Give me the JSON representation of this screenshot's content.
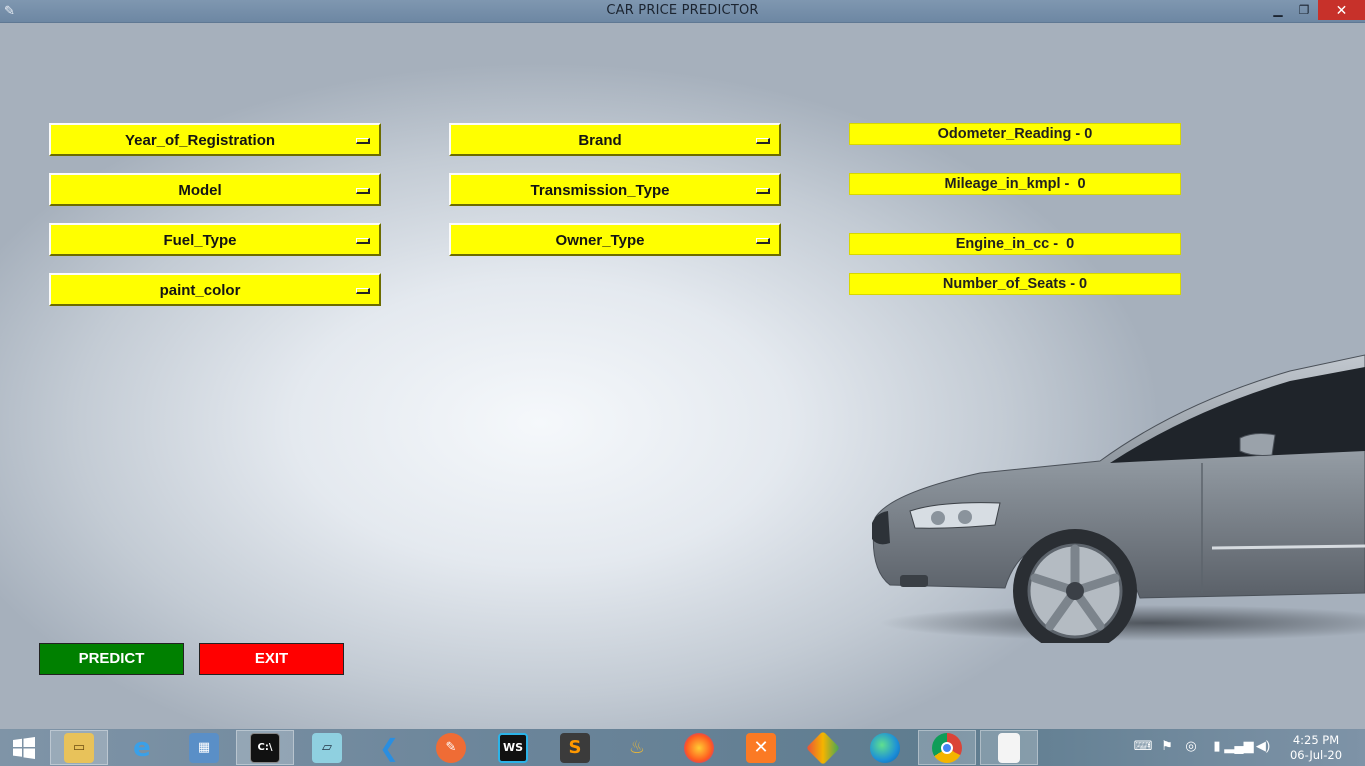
{
  "window": {
    "title": "CAR PRICE PREDICTOR",
    "minimize": "▁",
    "maximize": "❐",
    "close": "✕"
  },
  "dropdowns": {
    "year": "Year_of_Registration",
    "brand": "Brand",
    "model": "Model",
    "transmission": "Transmission_Type",
    "fuel": "Fuel_Type",
    "owner": "Owner_Type",
    "paint": "paint_color"
  },
  "info": {
    "odometer": "Odometer_Reading - 0",
    "mileage": "Mileage_in_kmpl -  0",
    "engine": "Engine_in_cc -  0",
    "seats": "Number_of_Seats - 0"
  },
  "buttons": {
    "predict": "PREDICT",
    "exit": "EXIT"
  },
  "taskbar": {
    "time": "4:25 PM",
    "date": "06-Jul-20",
    "apps": [
      "start-icon",
      "file-explorer-icon",
      "internet-explorer-icon",
      "control-panel-icon",
      "command-prompt-icon",
      "notepad-icon",
      "vscode-icon",
      "postman-icon",
      "webstorm-icon",
      "sublime-text-icon",
      "genie-lamp-icon",
      "firefox-icon",
      "xampp-icon",
      "git-extensions-icon",
      "edge-icon",
      "chrome-icon",
      "blank-file-icon"
    ]
  },
  "colors": {
    "field_yellow": "#ffff00",
    "predict_green": "#008000",
    "exit_red": "#ff0000"
  }
}
